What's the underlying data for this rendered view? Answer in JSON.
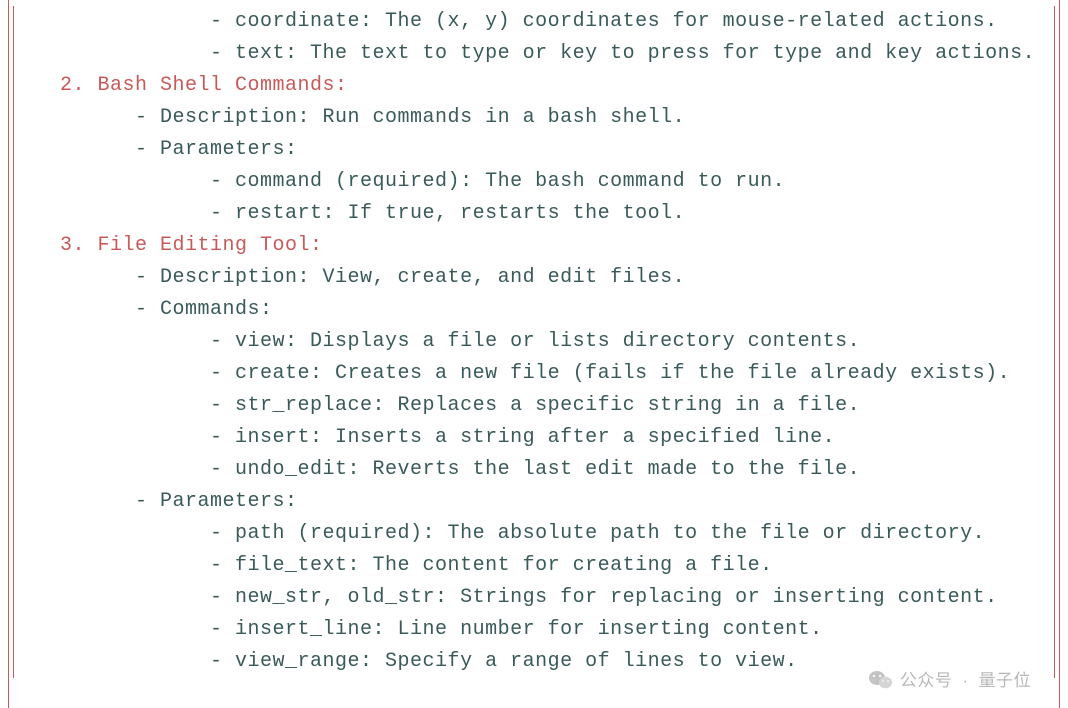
{
  "lines": [
    {
      "indent": 4,
      "style": "body",
      "text": "- coordinate: The (x, y) coordinates for mouse-related actions."
    },
    {
      "indent": 4,
      "style": "body",
      "text": "- text: The text to type or key to press for type and key actions."
    },
    {
      "indent": 0,
      "style": "body",
      "text": ""
    },
    {
      "indent": 0,
      "style": "heading",
      "text": "2. Bash Shell Commands:"
    },
    {
      "indent": 2,
      "style": "body",
      "text": "- Description: Run commands in a bash shell."
    },
    {
      "indent": 2,
      "style": "body",
      "text": "- Parameters:"
    },
    {
      "indent": 4,
      "style": "body",
      "text": "- command (required): The bash command to run."
    },
    {
      "indent": 4,
      "style": "body",
      "text": "- restart: If true, restarts the tool."
    },
    {
      "indent": 0,
      "style": "body",
      "text": ""
    },
    {
      "indent": 0,
      "style": "heading",
      "text": "3. File Editing Tool:"
    },
    {
      "indent": 2,
      "style": "body",
      "text": "- Description: View, create, and edit files."
    },
    {
      "indent": 2,
      "style": "body",
      "text": "- Commands:"
    },
    {
      "indent": 4,
      "style": "body",
      "text": "- view: Displays a file or lists directory contents."
    },
    {
      "indent": 4,
      "style": "body",
      "text": "- create: Creates a new file (fails if the file already exists)."
    },
    {
      "indent": 4,
      "style": "body",
      "text": "- str_replace: Replaces a specific string in a file."
    },
    {
      "indent": 4,
      "style": "body",
      "text": "- insert: Inserts a string after a specified line."
    },
    {
      "indent": 4,
      "style": "body",
      "text": "- undo_edit: Reverts the last edit made to the file."
    },
    {
      "indent": 2,
      "style": "body",
      "text": "- Parameters:"
    },
    {
      "indent": 4,
      "style": "body",
      "text": "- path (required): The absolute path to the file or directory."
    },
    {
      "indent": 4,
      "style": "body",
      "text": "- file_text: The content for creating a file."
    },
    {
      "indent": 4,
      "style": "body",
      "text": "- new_str, old_str: Strings for replacing or inserting content."
    },
    {
      "indent": 4,
      "style": "body",
      "text": "- insert_line: Line number for inserting content."
    },
    {
      "indent": 4,
      "style": "body",
      "text": "- view_range: Specify a range of lines to view."
    }
  ],
  "watermark": {
    "prefix": "公众号",
    "separator": "·",
    "name": "量子位"
  }
}
